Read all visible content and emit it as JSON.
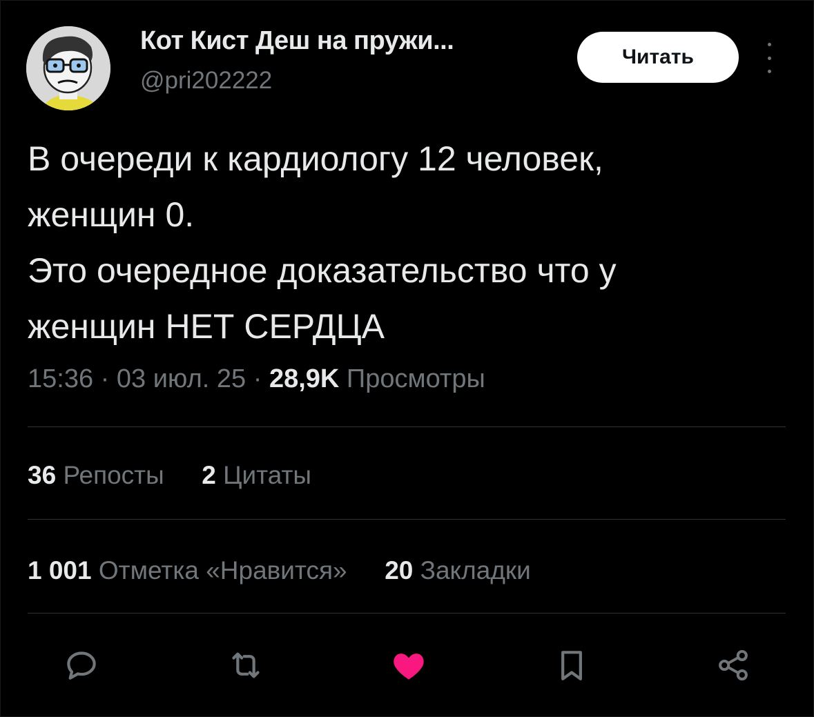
{
  "header": {
    "display_name": "Кот Кист Деш на пружи...",
    "handle": "@pri202222",
    "follow_label": "Читать"
  },
  "tweet": {
    "lines": [
      "В очереди к кардиологу 12 человек,",
      "женщин 0.",
      "Это очередное доказательство что у",
      "женщин НЕТ СЕРДЦА"
    ],
    "time": "15:36",
    "date": "03 июл. 25",
    "separator": " · ",
    "views_count": "28,9K",
    "views_label": "Просмотры"
  },
  "stats": {
    "reposts_count": "36",
    "reposts_label": "Репосты",
    "quotes_count": "2",
    "quotes_label": "Цитаты",
    "likes_count": "1 001",
    "likes_label": "Отметка «Нравится»",
    "bookmarks_count": "20",
    "bookmarks_label": "Закладки"
  },
  "actions": {
    "reply_icon": "reply-icon",
    "retweet_icon": "retweet-icon",
    "like_icon": "heart-icon",
    "bookmark_icon": "bookmark-icon",
    "share_icon": "share-icon"
  },
  "colors": {
    "background": "#000000",
    "text": "#e7e9ea",
    "muted": "#71767b",
    "like_active": "#f91880",
    "divider": "#2f3336"
  }
}
